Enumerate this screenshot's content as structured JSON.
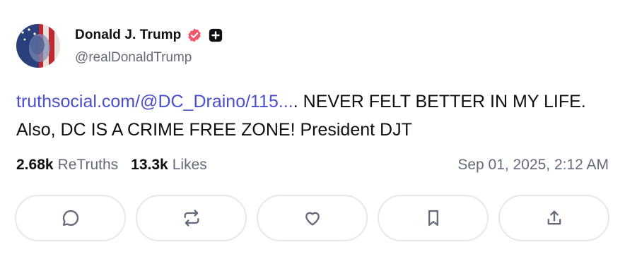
{
  "author": {
    "display_name": "Donald J. Trump",
    "handle": "@realDonaldTrump",
    "verified_icon": "verified-badge-icon",
    "extra_icon": "plus-badge-icon",
    "avatar_icon": "avatar"
  },
  "post": {
    "link_text": "truthsocial.com/@DC_Draino/115...",
    "body_text": ". NEVER FELT BETTER IN MY LIFE. Also, DC IS A CRIME FREE ZONE! President DJT"
  },
  "stats": {
    "retruths_count": "2.68k",
    "retruths_label": "ReTruths",
    "likes_count": "13.3k",
    "likes_label": "Likes",
    "timestamp": "Sep 01, 2025, 2:12 AM"
  },
  "actions": [
    {
      "name": "reply-button",
      "icon": "comment-icon"
    },
    {
      "name": "retruth-button",
      "icon": "repost-icon"
    },
    {
      "name": "like-button",
      "icon": "heart-icon"
    },
    {
      "name": "bookmark-button",
      "icon": "bookmark-icon"
    },
    {
      "name": "share-button",
      "icon": "share-icon"
    }
  ],
  "colors": {
    "link": "#4a4fcf",
    "verified": "#f0586c",
    "muted": "#656b78",
    "border": "#e6e8ee"
  }
}
